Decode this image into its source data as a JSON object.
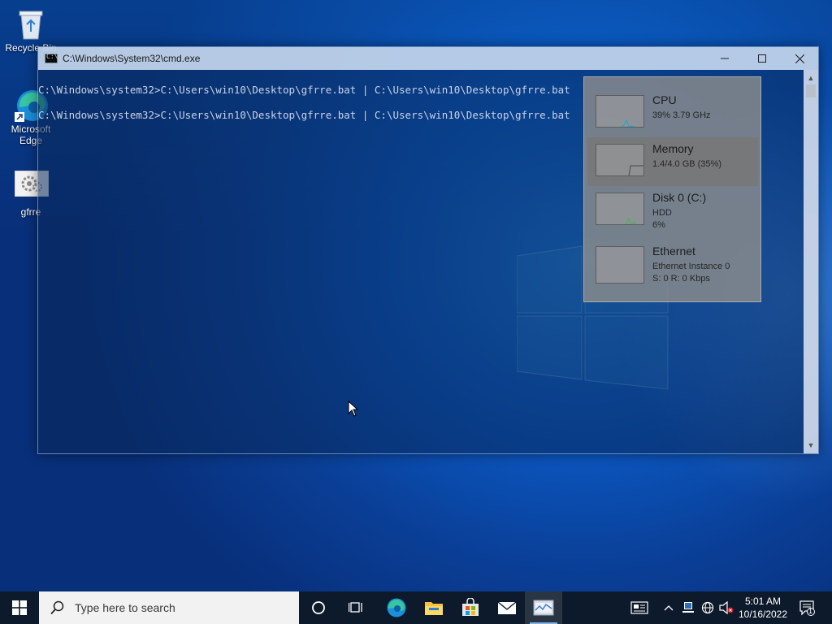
{
  "desktop": {
    "icons": [
      {
        "label": "Recycle Bin",
        "icon": "recycle-bin-icon"
      },
      {
        "label": "Microsoft Edge",
        "icon": "edge-icon"
      },
      {
        "label": "gfrre",
        "icon": "batch-file-icon"
      }
    ]
  },
  "cmd_window": {
    "title": "C:\\Windows\\System32\\cmd.exe",
    "lines": [
      "C:\\Windows\\system32>C:\\Users\\win10\\Desktop\\gfrre.bat | C:\\Users\\win10\\Desktop\\gfrre.bat",
      "C:\\Windows\\system32>C:\\Users\\win10\\Desktop\\gfrre.bat | C:\\Users\\win10\\Desktop\\gfrre.bat"
    ],
    "controls": {
      "minimize": "minimize-icon",
      "maximize": "maximize-icon",
      "close": "close-icon"
    }
  },
  "performance_panel": {
    "items": [
      {
        "name": "CPU",
        "lines": [
          "39%  3.79 GHz"
        ],
        "graph_color": "#2aa3c8"
      },
      {
        "name": "Memory",
        "lines": [
          "1.4/4.0 GB (35%)"
        ],
        "graph_color": "#6a3aa8",
        "selected": true
      },
      {
        "name": "Disk 0 (C:)",
        "lines": [
          "HDD",
          "6%"
        ],
        "graph_color": "#4caf50"
      },
      {
        "name": "Ethernet",
        "lines": [
          "Ethernet Instance 0",
          "S: 0  R: 0 Kbps"
        ],
        "graph_color": "#a07020"
      }
    ]
  },
  "taskbar": {
    "search_placeholder": "Type here to search",
    "apps": [
      "cortana-icon",
      "task-view-icon",
      "edge-icon",
      "file-explorer-icon",
      "microsoft-store-icon",
      "mail-icon",
      "task-manager-icon"
    ],
    "tray": [
      "news-icon",
      "chevron-up-icon",
      "network-icon",
      "language-icon",
      "volume-muted-icon"
    ],
    "clock": {
      "time": "5:01 AM",
      "date": "10/16/2022"
    },
    "notifications": {
      "count": "1"
    }
  }
}
